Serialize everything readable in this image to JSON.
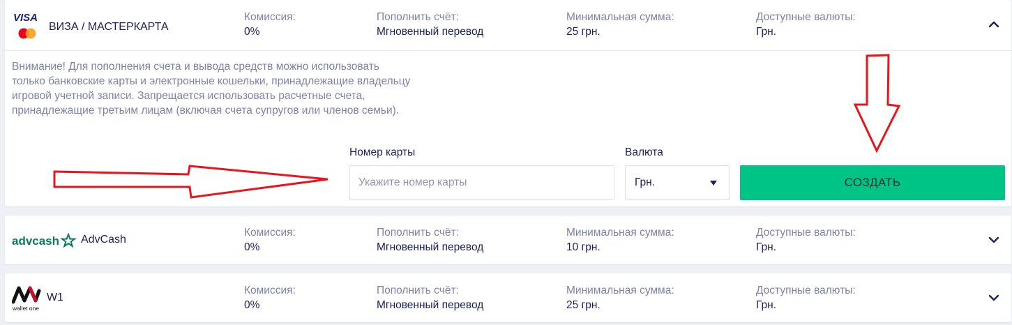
{
  "colors": {
    "background": "#eef0f5",
    "card": "#ffffff",
    "label": "#7d82a8",
    "value": "#1b1f5e",
    "accent_green": "#00c386",
    "visa_blue": "#1a1f71",
    "mc_red": "#eb001b",
    "mc_orange": "#f79e1b",
    "advcash_green": "#0c7c59",
    "annotation_red": "#e8161c"
  },
  "labels": {
    "commission": "Комиссия:",
    "deposit": "Пополнить счёт:",
    "min_amount": "Минимальная сумма:",
    "currencies": "Доступные валюты:"
  },
  "methods": [
    {
      "name": "ВИЗА / МАСТЕРКАРТА",
      "logo_text": "VISA",
      "logo_icon": "visa-mastercard-logo",
      "commission": "0%",
      "deposit": "Мгновенный перевод",
      "min_amount": "25 грн.",
      "currencies": "Грн.",
      "expanded": true,
      "chevron": "chevron-up-icon"
    },
    {
      "name": "AdvCash",
      "logo_text": "advcash",
      "logo_icon": "advcash-logo",
      "commission": "0%",
      "deposit": "Мгновенный перевод",
      "min_amount": "10 грн.",
      "currencies": "Грн.",
      "expanded": false,
      "chevron": "chevron-down-icon"
    },
    {
      "name": "W1",
      "logo_text": "wallet one",
      "logo_icon": "wallet-one-logo",
      "commission": "0%",
      "deposit": "Мгновенный перевод",
      "min_amount": "25 грн.",
      "currencies": "Грн.",
      "expanded": false,
      "chevron": "chevron-down-icon"
    }
  ],
  "form": {
    "warning": "Внимание! Для пополнения счета и вывода средств можно использовать только банковские карты и электронные кошельки, принадлежащие владельцу игровой учетной записи. Запрещается использовать расчетные счета, принадлежащие третьим лицам (включая счета супругов или членов семьи).",
    "card_label": "Номер карты",
    "card_placeholder": "Укажите номер карты",
    "card_value": "",
    "currency_label": "Валюта",
    "currency_selected": "Грн.",
    "create_button": "СОЗДАТЬ"
  }
}
